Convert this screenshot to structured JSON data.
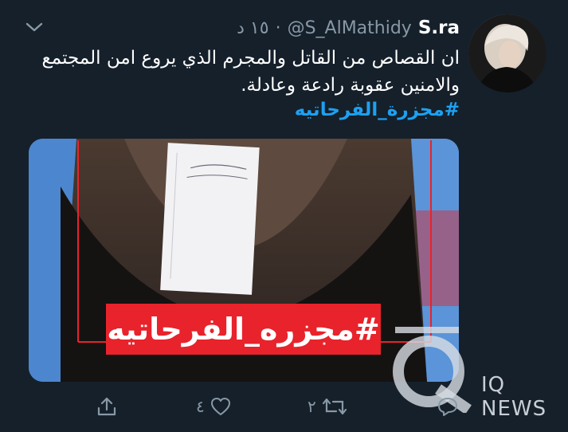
{
  "tweet": {
    "display_name": "S.ra",
    "handle": "@S_AlMathidy",
    "separator": "·",
    "time": "١٥ د",
    "text": "ان القصاص من القاتل والمجرم الذي يروع امن المجتمع والامنين عقوبة رادعة وعادلة.",
    "hashtag": "#مجزرة_الفرحاتيه"
  },
  "media": {
    "banner_text": "#مجزره_الفرحاتيه",
    "watermark_text": "IQ NEWS"
  },
  "actions": {
    "reply_count": "",
    "retweet_count": "٢",
    "like_count": "٤"
  },
  "colors": {
    "background": "#15202b",
    "secondary_text": "#8899a6",
    "link": "#1da1f2",
    "banner_red": "#e8232b"
  },
  "icons": {
    "menu": "chevron-down-icon",
    "reply": "reply-icon",
    "retweet": "retweet-icon",
    "like": "heart-icon",
    "share": "share-icon"
  }
}
